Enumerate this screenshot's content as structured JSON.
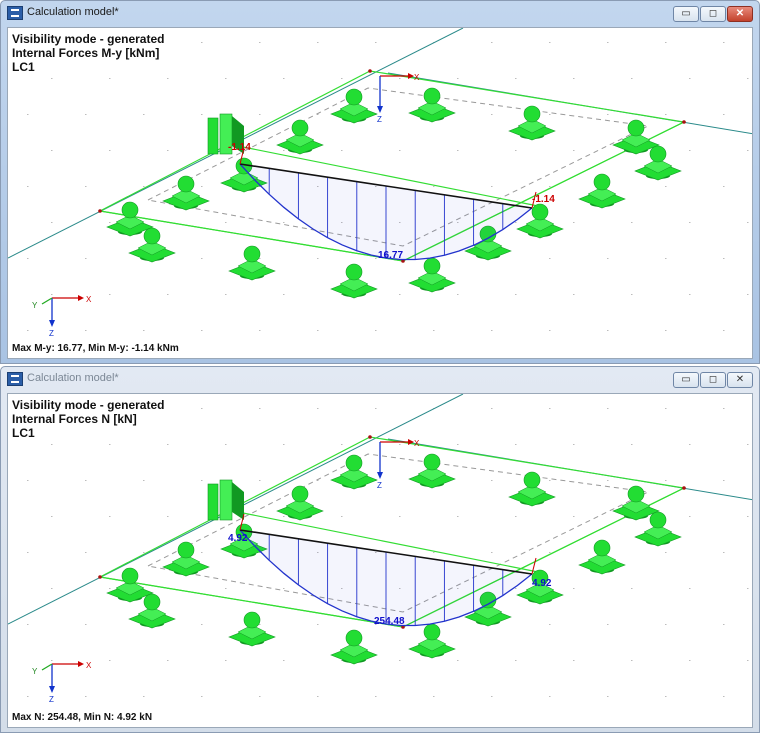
{
  "windows": [
    {
      "title": "Calculation model*",
      "info": [
        "Visibility mode - generated",
        "Internal Forces M-y [kNm]",
        "LC1"
      ],
      "summary": "Max M-y: 16.77, Min M-y: -1.14 kNm",
      "labels": {
        "left_end": "-1.14",
        "right_end": "-1.14",
        "max": "16.77"
      },
      "label_color": "#cc0000"
    },
    {
      "title": "Calculation model*",
      "info": [
        "Visibility mode - generated",
        "Internal Forces N [kN]",
        "LC1"
      ],
      "summary": "Max N: 254.48, Min N: 4.92 kN",
      "labels": {
        "left_end": "4.92",
        "right_end": "4.92",
        "max": "254.48"
      },
      "label_color": "#1010cc"
    }
  ],
  "window_controls": {
    "minimize": "▭",
    "maximize": "◻",
    "close": "✕"
  },
  "axes": {
    "x": "X",
    "y": "Y",
    "z": "Z",
    "x_model": "X",
    "z_model": "Z"
  },
  "colors": {
    "support": "#22dd33",
    "support_dark": "#119922",
    "frame": "#33dd33",
    "diagram": "#2233cc",
    "member": "#111111",
    "grid": "#2a8a8a"
  },
  "icons": {
    "app": "rfem-app-icon"
  }
}
